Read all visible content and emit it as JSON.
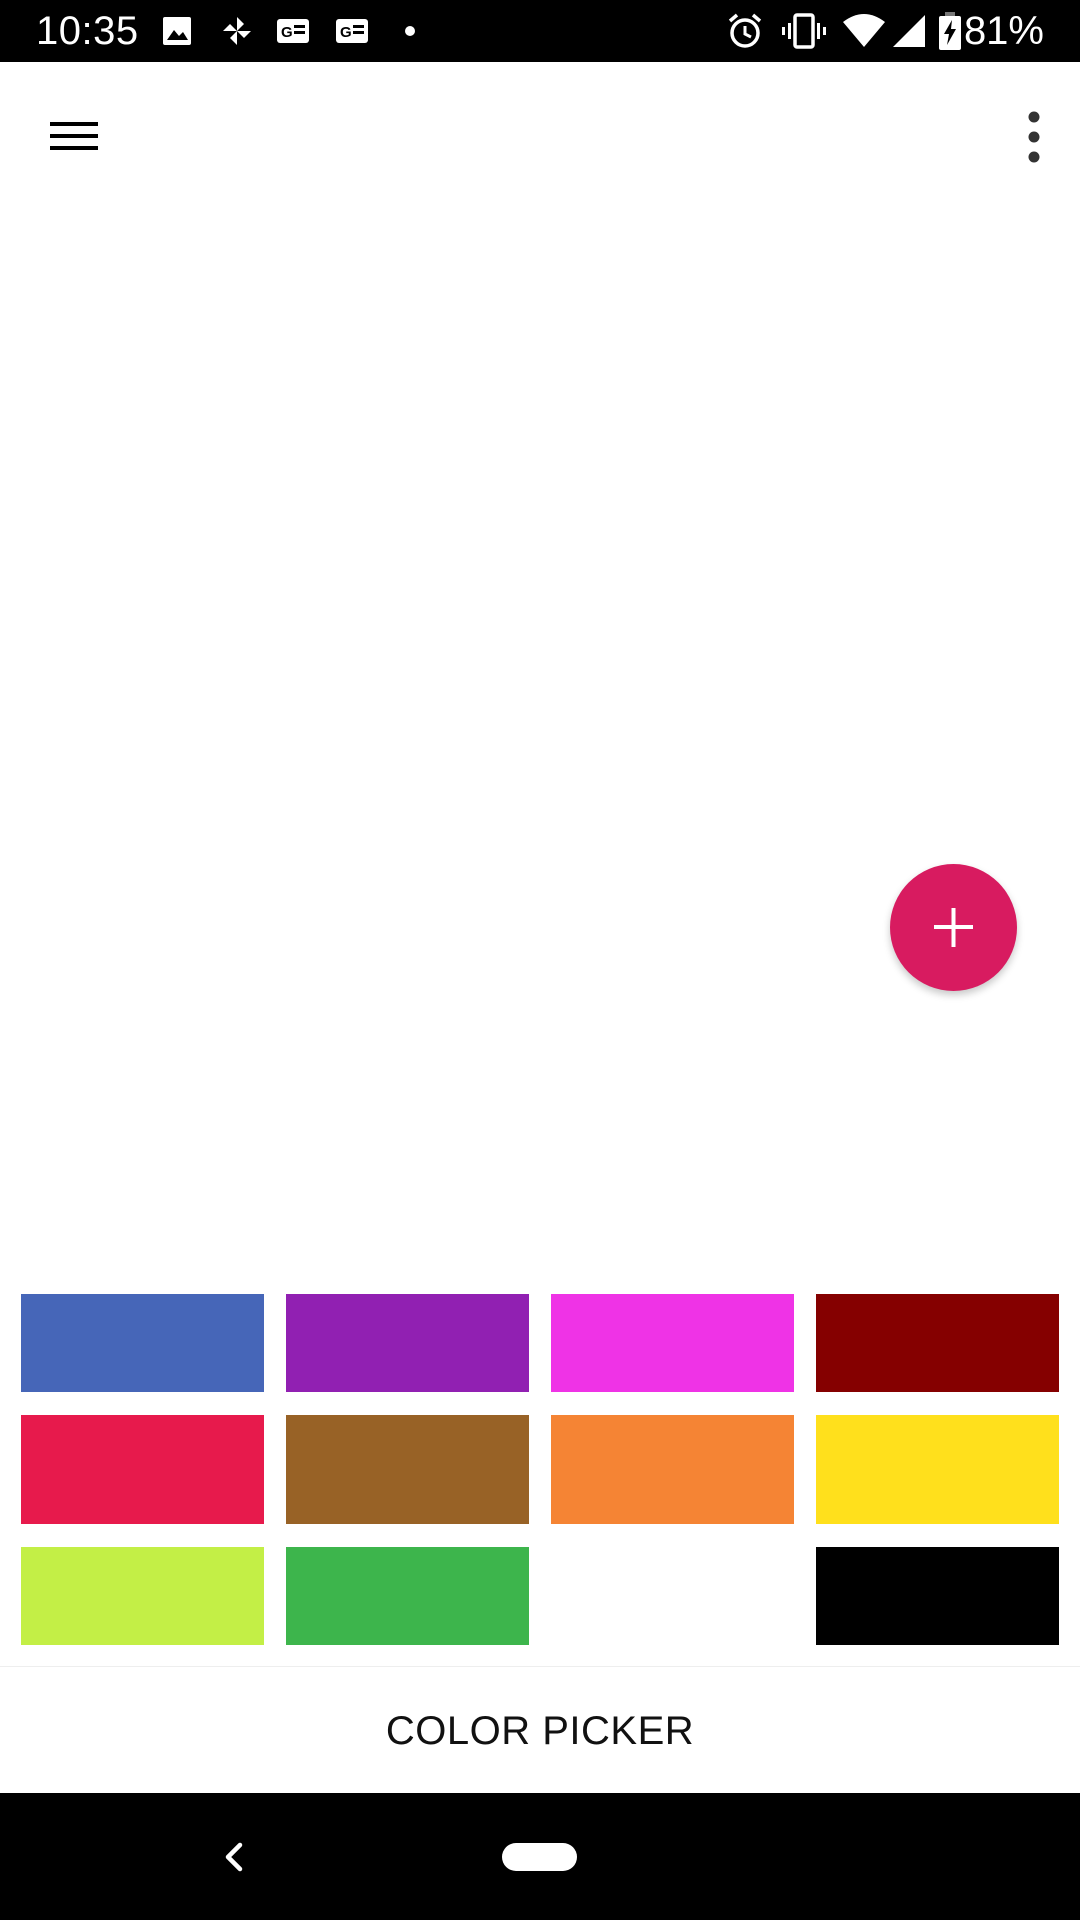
{
  "status_bar": {
    "time": "10:35",
    "battery_percent": "81%",
    "left_icons": [
      "image-icon",
      "pinwheel-icon",
      "news-icon",
      "news-icon",
      "dot-icon"
    ],
    "right_icons": [
      "alarm-icon",
      "vibrate-icon",
      "wifi-icon",
      "signal-icon",
      "battery-charging-icon"
    ]
  },
  "app_bar": {
    "menu_icon": "hamburger-menu-icon",
    "overflow_icon": "more-vert-icon"
  },
  "fab": {
    "icon": "plus-icon",
    "color": "#D81B60"
  },
  "colors": {
    "row1": [
      "#4666B8",
      "#9120B2",
      "#EF33E6",
      "#850000"
    ],
    "row2": [
      "#E71A4C",
      "#986226",
      "#F58434",
      "#FFE01C"
    ],
    "row3": [
      "#C3EF46",
      "#3DB54C",
      "#FFFFFF",
      "#000000"
    ]
  },
  "bottom_bar": {
    "title": "COLOR PICKER"
  },
  "nav_bar": {
    "back_icon": "back-chevron-icon",
    "home_icon": "home-pill-icon"
  }
}
